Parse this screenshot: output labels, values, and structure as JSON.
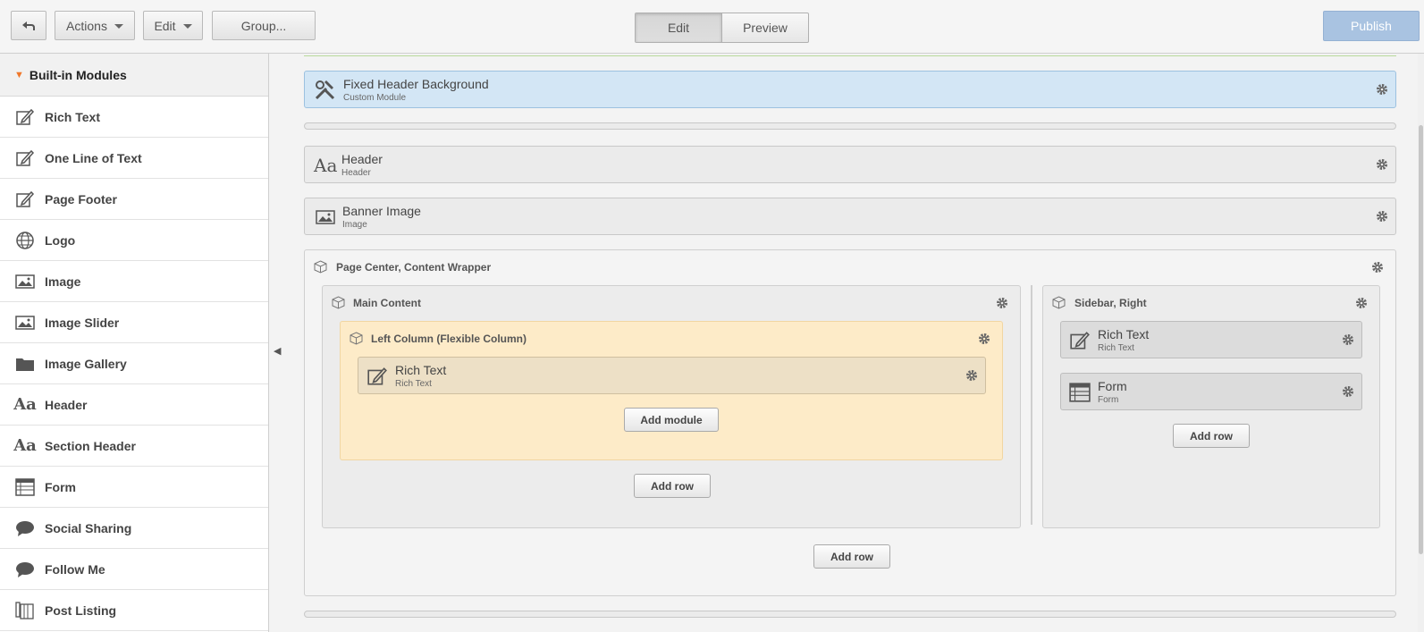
{
  "toolbar": {
    "back_icon": "back-arrow-icon",
    "actions_label": "Actions",
    "edit_label": "Edit",
    "group_label": "Group...",
    "mode_edit": "Edit",
    "mode_preview": "Preview",
    "publish_label": "Publish"
  },
  "sidebar": {
    "title": "Built-in Modules",
    "items": [
      {
        "label": "Rich Text",
        "icon": "edit-icon"
      },
      {
        "label": "One Line of Text",
        "icon": "edit-icon"
      },
      {
        "label": "Page Footer",
        "icon": "edit-icon"
      },
      {
        "label": "Logo",
        "icon": "globe-icon"
      },
      {
        "label": "Image",
        "icon": "image-icon"
      },
      {
        "label": "Image Slider",
        "icon": "image-icon"
      },
      {
        "label": "Image Gallery",
        "icon": "folder-icon"
      },
      {
        "label": "Header",
        "icon": "text-aa-icon"
      },
      {
        "label": "Section Header",
        "icon": "text-aa-icon"
      },
      {
        "label": "Form",
        "icon": "form-icon"
      },
      {
        "label": "Social Sharing",
        "icon": "speech-bubble-icon"
      },
      {
        "label": "Follow Me",
        "icon": "speech-bubble-icon"
      },
      {
        "label": "Post Listing",
        "icon": "post-listing-icon"
      }
    ]
  },
  "canvas": {
    "fixed_header": {
      "title": "Fixed Header Background",
      "subtitle": "Custom Module"
    },
    "header": {
      "title": "Header",
      "subtitle": "Header"
    },
    "banner": {
      "title": "Banner Image",
      "subtitle": "Image"
    },
    "wrapper": {
      "title": "Page Center, Content Wrapper"
    },
    "main_content": {
      "title": "Main Content"
    },
    "left_column": {
      "title": "Left Column (Flexible Column)"
    },
    "left_rich_text": {
      "title": "Rich Text",
      "subtitle": "Rich Text"
    },
    "add_module": "Add module",
    "add_row_main": "Add row",
    "sidebar_right": {
      "title": "Sidebar, Right"
    },
    "sidebar_rich_text": {
      "title": "Rich Text",
      "subtitle": "Rich Text"
    },
    "sidebar_form": {
      "title": "Form",
      "subtitle": "Form"
    },
    "add_row_sidebar": "Add row",
    "add_row_wrapper": "Add row"
  },
  "colors": {
    "accent_orange": "#f0782a",
    "publish_blue": "#a9c3e1",
    "selected_module": "#d3e6f5",
    "left_column_bg": "#fdebc8"
  }
}
